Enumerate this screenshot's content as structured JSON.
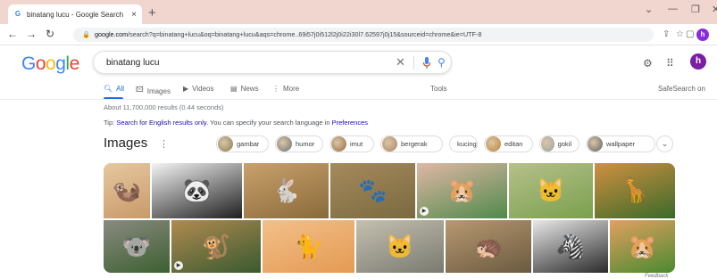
{
  "browser": {
    "tab_title": "binatang lucu - Google Search",
    "tab_close": "×",
    "new_tab": "+",
    "url_host": "google.com",
    "url_path": "/search?q=binatang+lucu&oq=binatang+lucu&aqs=chrome..69i57j0i512l2j0i22i30l7.62597j0j15&sourceid=chrome&ie=UTF-8",
    "profile_initial": "h",
    "back_icon": "arrow-left-icon",
    "forward_icon": "arrow-right-icon",
    "reload_icon": "reload-icon"
  },
  "search": {
    "logo_letters": [
      "G",
      "o",
      "o",
      "g",
      "l",
      "e"
    ],
    "logo_colors": [
      "#4285f4",
      "#ea4335",
      "#fbbc05",
      "#4285f4",
      "#34a853",
      "#ea4335"
    ],
    "query": "binatang lucu",
    "clear_symbol": "✕",
    "avatar_initial": "h"
  },
  "tabs": [
    {
      "label": "All",
      "icon": "search-icon",
      "active": true
    },
    {
      "label": "Images",
      "icon": "image-icon",
      "active": false
    },
    {
      "label": "Videos",
      "icon": "video-icon",
      "active": false
    },
    {
      "label": "News",
      "icon": "news-icon",
      "active": false
    },
    {
      "label": "More",
      "icon": "more-vertical-icon",
      "active": false
    }
  ],
  "tools_label": "Tools",
  "safesearch_label": "SafeSearch on",
  "result_stats": "About 11,700,000 results (0.44 seconds)",
  "tip": {
    "prefix": "Tip: ",
    "link1": "Search for English results only",
    "middle": ". You can specify your search language in ",
    "link2": "Preferences"
  },
  "images_section": {
    "heading": "Images",
    "chips": [
      {
        "label": "gambar",
        "thumb_color": "#8a7a50"
      },
      {
        "label": "humor",
        "thumb_color": "#707070"
      },
      {
        "label": "imut",
        "thumb_color": "#9a6a40"
      },
      {
        "label": "bergerak",
        "thumb_color": "#b08060"
      },
      {
        "label": "kucing",
        "thumb_color": ""
      },
      {
        "label": "editan",
        "thumb_color": "#c08030"
      },
      {
        "label": "gokil",
        "thumb_color": "#a0a0a0"
      },
      {
        "label": "wallpaper",
        "thumb_color": "#606060"
      }
    ],
    "images": [
      {
        "name": "meerkat",
        "bg": "#c89a6a",
        "bg2": "#e6c8a0",
        "glyph": "🦦",
        "play": false
      },
      {
        "name": "panda",
        "bg": "#1f1f1f",
        "bg2": "#f4f4f4",
        "glyph": "🐼",
        "play": false
      },
      {
        "name": "rabbit",
        "bg": "#8a6a3a",
        "bg2": "#c9a16c",
        "glyph": "🐇",
        "play": false
      },
      {
        "name": "quokka",
        "bg": "#7a6a40",
        "bg2": "#a58a5c",
        "glyph": "🐾",
        "play": false
      },
      {
        "name": "hamster-hand",
        "bg": "#4f8a4a",
        "bg2": "#e0b7a6",
        "glyph": "🐹",
        "play": true
      },
      {
        "name": "kitten-grey",
        "bg": "#7aa04e",
        "bg2": "#b6c08a",
        "glyph": "🐱",
        "play": false
      },
      {
        "name": "giraffe",
        "bg": "#3a6a2a",
        "bg2": "#d09040",
        "glyph": "🦒",
        "play": false
      },
      {
        "name": "koala",
        "bg": "#3c6030",
        "bg2": "#8a8a80",
        "glyph": "🐨",
        "play": false
      },
      {
        "name": "slow-loris",
        "bg": "#385a30",
        "bg2": "#b08a50",
        "glyph": "🐒",
        "play": true
      },
      {
        "name": "orange-kitten",
        "bg": "#e49a52",
        "bg2": "#f2c08a",
        "glyph": "🐈",
        "play": false
      },
      {
        "name": "tabby-kitten",
        "bg": "#7a7a70",
        "bg2": "#c4c0b0",
        "glyph": "🐱",
        "play": false
      },
      {
        "name": "hedgehog",
        "bg": "#6a5a40",
        "bg2": "#b89870",
        "glyph": "🦔",
        "play": false
      },
      {
        "name": "zebra",
        "bg": "#2a2a2a",
        "bg2": "#e8e8e8",
        "glyph": "🦓",
        "play": false
      },
      {
        "name": "hamster-orange",
        "bg": "#4a8a30",
        "bg2": "#e2a060",
        "glyph": "🐹",
        "play": false
      }
    ]
  },
  "feedback_label": "Feedback"
}
